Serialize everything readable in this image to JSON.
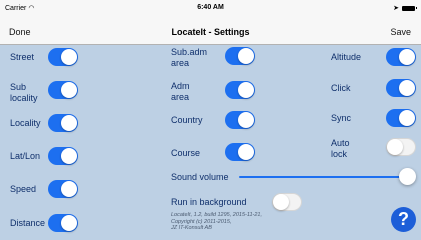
{
  "status": {
    "carrier": "Carrier",
    "wifi_icon": "wifi-icon",
    "time": "6:40 AM",
    "location_icon": "location-arrow-icon",
    "battery_icon": "battery-icon"
  },
  "nav": {
    "done": "Done",
    "title": "LocateIt - Settings",
    "save": "Save"
  },
  "settings": {
    "street": "Street",
    "sub_locality": "Sub\nlocality",
    "locality": "Locality",
    "latlon": "Lat/Lon",
    "speed": "Speed",
    "distance": "Distance",
    "sub_adm_area": "Sub.adm\narea",
    "adm_area": "Adm\narea",
    "country": "Country",
    "course": "Course",
    "altitude": "Altitude",
    "click": "Click",
    "sync": "Sync",
    "auto_lock": "Auto\nlock",
    "sound_volume": "Sound volume",
    "run_in_background": "Run in background"
  },
  "toggles": {
    "street": "on",
    "sub_locality": "on",
    "locality": "on",
    "latlon": "on",
    "speed": "on",
    "distance": "on",
    "sub_adm_area": "on",
    "adm_area": "on",
    "country": "on",
    "course": "on",
    "altitude": "on",
    "click": "on",
    "sync": "on",
    "auto_lock": "off",
    "run_in_background": "off"
  },
  "sound_volume_level": 1.0,
  "version_info": "LocateIt, 1.2, build 1295, 2015-11-21,\nCopyright (c) 2011-2015,\nJZ IT-Konsult AB",
  "help": {
    "label": "?",
    "icon": "help-icon"
  },
  "colors": {
    "accent": "#1d6ff0",
    "background": "#bdd0e4",
    "label": "#0f2f6b"
  }
}
